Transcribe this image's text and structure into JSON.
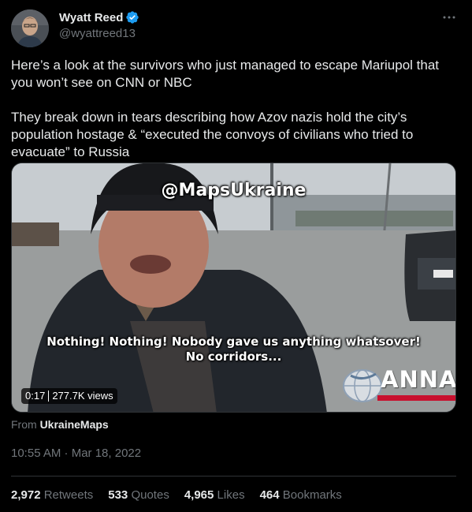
{
  "author": {
    "name": "Wyatt Reed",
    "handle": "@wyattreed13",
    "verified_color": "#1d9bf0"
  },
  "tweet": {
    "paragraphs": [
      "Here’s a look at the survivors who just managed to escape Mariupol that you won’t see on CNN or NBC",
      "They break down in tears describing how Azov nazis hold the city’s population hostage & “executed the convoys of civilians who tried to evacuate” to Russia"
    ]
  },
  "media": {
    "watermark": "@MapsUkraine",
    "subtitle_line1": "Nothing! Nothing! Nobody gave us anything whatsover!",
    "subtitle_line2": "No corridors...",
    "logo_text": "ANNA",
    "duration": "0:17",
    "views": "277.7K views"
  },
  "source": {
    "prefix": "From",
    "name": "UkraineMaps"
  },
  "timestamp": "10:55 AM · Mar 18, 2022",
  "stats": [
    {
      "value": "2,972",
      "label": "Retweets"
    },
    {
      "value": "533",
      "label": "Quotes"
    },
    {
      "value": "4,965",
      "label": "Likes"
    },
    {
      "value": "464",
      "label": "Bookmarks"
    }
  ],
  "icons": {
    "verified": "verified-badge-icon",
    "more": "more-horizontal-icon"
  }
}
